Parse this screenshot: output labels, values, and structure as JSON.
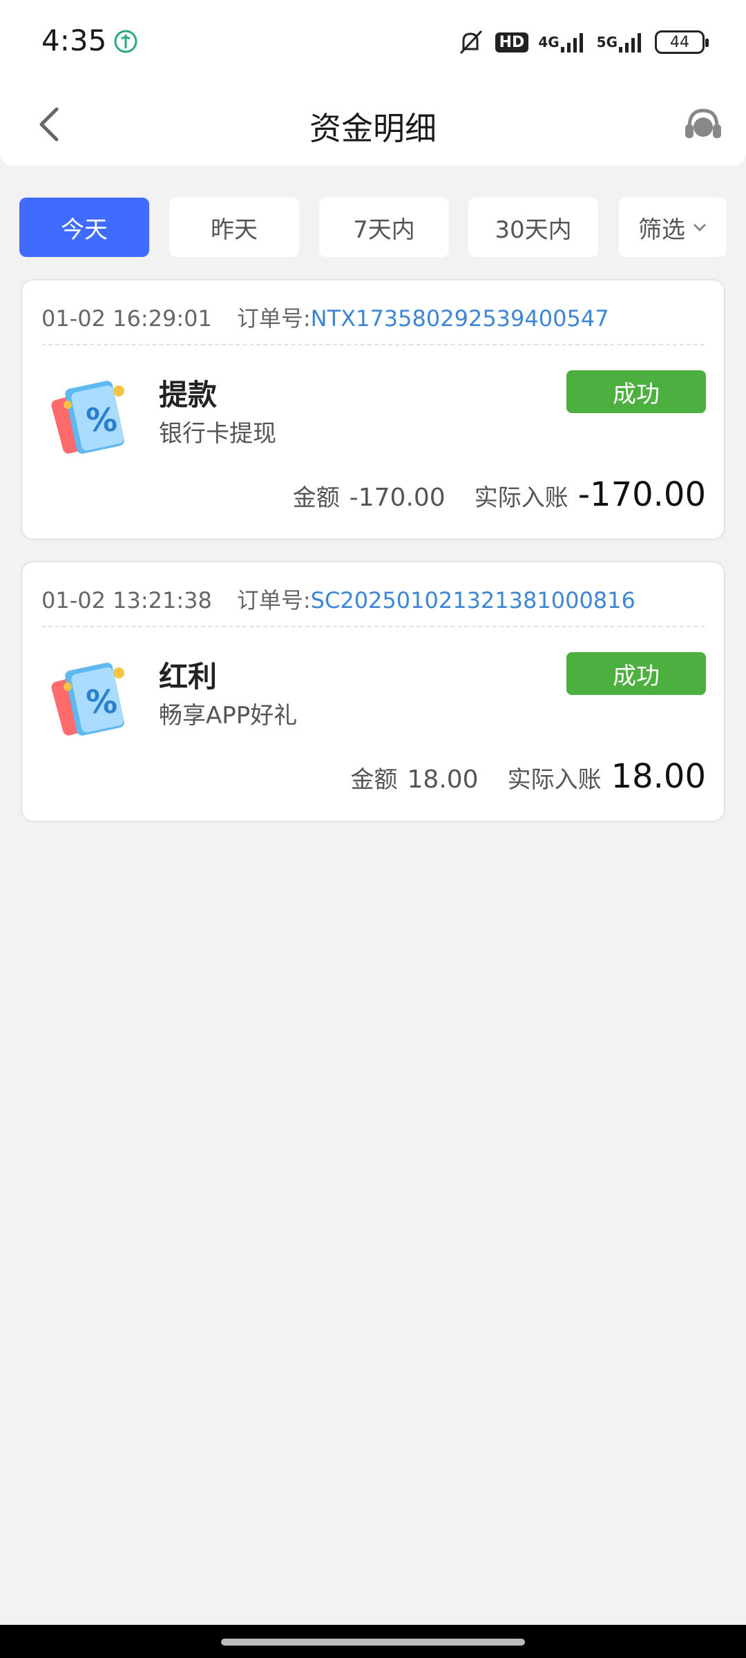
{
  "status_bar": {
    "time": "4:35",
    "app_icon": "leaf-icon",
    "hd_label": "HD",
    "net1": "4G",
    "net2": "5G",
    "battery": "44"
  },
  "header": {
    "title": "资金明细",
    "back_icon": "chevron-left-icon",
    "service_icon": "headset-icon"
  },
  "filters": {
    "tabs": [
      {
        "label": "今天",
        "active": true
      },
      {
        "label": "昨天",
        "active": false
      },
      {
        "label": "7天内",
        "active": false
      },
      {
        "label": "30天内",
        "active": false
      }
    ],
    "filter_label": "筛选"
  },
  "records": [
    {
      "datetime": "01-02 16:29:01",
      "order_label": "订单号:",
      "order_no": "NTX173580292539400547",
      "title": "提款",
      "subtitle": "银行卡提现",
      "status": "成功",
      "amount_label": "金额",
      "amount": "-170.00",
      "actual_label": "实际入账",
      "actual": "-170.00"
    },
    {
      "datetime": "01-02 13:21:38",
      "order_label": "订单号:",
      "order_no": "SC20250102132138100081​6",
      "title": "红利",
      "subtitle": "畅享APP好礼",
      "status": "成功",
      "amount_label": "金额",
      "amount": "18.00",
      "actual_label": "实际入账",
      "actual": "18.00"
    }
  ],
  "colors": {
    "accent": "#3f6cff",
    "success": "#4caf3f",
    "link": "#3d86d6",
    "background": "#f2f2f2"
  }
}
